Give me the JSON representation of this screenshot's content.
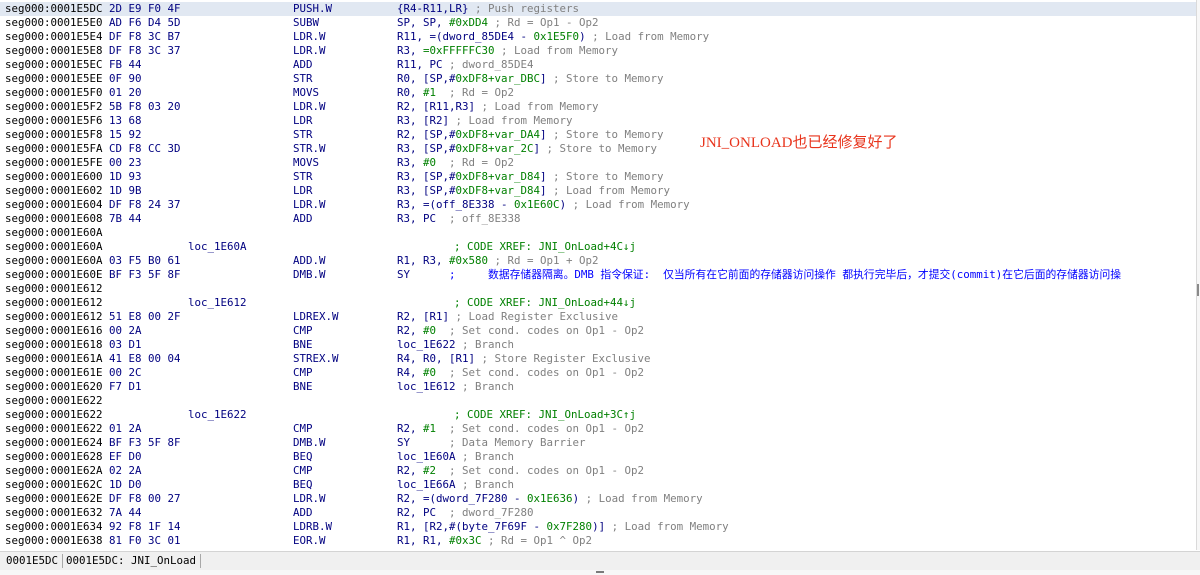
{
  "colors": {
    "address": "#000000",
    "bytes": "#000080",
    "label": "#000080",
    "mnemonic": "#000080",
    "operand": "#000080",
    "number": "#008000",
    "auto_comment": "#808080",
    "xref_comment": "#008000",
    "user_comment": "#0000ff",
    "highlight": "#e1e8f2",
    "annotation": "#e8341c"
  },
  "listing": {
    "lines": [
      {
        "addr": "seg000:0001E5DC",
        "bytes": "2D E9 F0 4F",
        "mnem": "PUSH.W",
        "ops": [
          {
            "op": "{R4-R11,LR}"
          }
        ],
        "cmt": "; Push registers",
        "current": true
      },
      {
        "addr": "seg000:0001E5E0",
        "bytes": "AD F6 D4 5D",
        "mnem": "SUBW",
        "ops": [
          {
            "op": "SP, SP, "
          },
          {
            "num": "#0xDD4"
          }
        ],
        "cmt": "; Rd = Op1 - Op2"
      },
      {
        "addr": "seg000:0001E5E4",
        "bytes": "DF F8 3C B7",
        "mnem": "LDR.W",
        "ops": [
          {
            "op": "R11, =("
          },
          {
            "ref": "dword_85DE4"
          },
          {
            "op": " - "
          },
          {
            "num": "0x1E5F0"
          },
          {
            "op": ")"
          }
        ],
        "cmt": "; Load from Memory"
      },
      {
        "addr": "seg000:0001E5E8",
        "bytes": "DF F8 3C 37",
        "mnem": "LDR.W",
        "ops": [
          {
            "op": "R3, "
          },
          {
            "num": "=0xFFFFFC30"
          }
        ],
        "cmt": "; Load from Memory"
      },
      {
        "addr": "seg000:0001E5EC",
        "bytes": "FB 44",
        "mnem": "ADD",
        "ops": [
          {
            "op": "R11, PC"
          }
        ],
        "cmt": "; dword_85DE4"
      },
      {
        "addr": "seg000:0001E5EE",
        "bytes": "0F 90",
        "mnem": "STR",
        "ops": [
          {
            "op": "R0, [SP,#"
          },
          {
            "num": "0xDF8+var_DBC"
          },
          {
            "op": "]"
          }
        ],
        "cmt": "; Store to Memory"
      },
      {
        "addr": "seg000:0001E5F0",
        "bytes": "01 20",
        "mnem": "MOVS",
        "ops": [
          {
            "op": "R0, "
          },
          {
            "num": "#1"
          }
        ],
        "cmt": "; Rd = Op2"
      },
      {
        "addr": "seg000:0001E5F2",
        "bytes": "5B F8 03 20",
        "mnem": "LDR.W",
        "ops": [
          {
            "op": "R2, [R11,R3]"
          }
        ],
        "cmt": "; Load from Memory"
      },
      {
        "addr": "seg000:0001E5F6",
        "bytes": "13 68",
        "mnem": "LDR",
        "ops": [
          {
            "op": "R3, [R2]"
          }
        ],
        "cmt": "; Load from Memory"
      },
      {
        "addr": "seg000:0001E5F8",
        "bytes": "15 92",
        "mnem": "STR",
        "ops": [
          {
            "op": "R2, [SP,#"
          },
          {
            "num": "0xDF8+var_DA4"
          },
          {
            "op": "]"
          }
        ],
        "cmt": "; Store to Memory"
      },
      {
        "addr": "seg000:0001E5FA",
        "bytes": "CD F8 CC 3D",
        "mnem": "STR.W",
        "ops": [
          {
            "op": "R3, [SP,#"
          },
          {
            "num": "0xDF8+var_2C"
          },
          {
            "op": "]"
          }
        ],
        "cmt": "; Store to Memory"
      },
      {
        "addr": "seg000:0001E5FE",
        "bytes": "00 23",
        "mnem": "MOVS",
        "ops": [
          {
            "op": "R3, "
          },
          {
            "num": "#0"
          }
        ],
        "cmt": "; Rd = Op2"
      },
      {
        "addr": "seg000:0001E600",
        "bytes": "1D 93",
        "mnem": "STR",
        "ops": [
          {
            "op": "R3, [SP,#"
          },
          {
            "num": "0xDF8+var_D84"
          },
          {
            "op": "]"
          }
        ],
        "cmt": "; Store to Memory"
      },
      {
        "addr": "seg000:0001E602",
        "bytes": "1D 9B",
        "mnem": "LDR",
        "ops": [
          {
            "op": "R3, [SP,#"
          },
          {
            "num": "0xDF8+var_D84"
          },
          {
            "op": "]"
          }
        ],
        "cmt": "; Load from Memory"
      },
      {
        "addr": "seg000:0001E604",
        "bytes": "DF F8 24 37",
        "mnem": "LDR.W",
        "ops": [
          {
            "op": "R3, =("
          },
          {
            "ref": "off_8E338"
          },
          {
            "op": " - "
          },
          {
            "num": "0x1E60C"
          },
          {
            "op": ")"
          }
        ],
        "cmt": "; Load from Memory"
      },
      {
        "addr": "seg000:0001E608",
        "bytes": "7B 44",
        "mnem": "ADD",
        "ops": [
          {
            "op": "R3, PC"
          }
        ],
        "cmt": "; off_8E338"
      },
      {
        "addr": "seg000:0001E60A"
      },
      {
        "addr": "seg000:0001E60A",
        "label": "loc_1E60A",
        "xref": "; CODE XREF: JNI_OnLoad+4C↓j"
      },
      {
        "addr": "seg000:0001E60A",
        "bytes": "03 F5 B0 61",
        "mnem": "ADD.W",
        "ops": [
          {
            "op": "R1, R3, "
          },
          {
            "num": "#0x580"
          }
        ],
        "cmt": "; Rd = Op1 + Op2"
      },
      {
        "addr": "seg000:0001E60E",
        "bytes": "BF F3 5F 8F",
        "mnem": "DMB.W",
        "ops": [
          {
            "op": "SY"
          }
        ],
        "ucmt": ";     数据存储器隔离。DMB 指令保证:  仅当所有在它前面的存储器访问操作 都执行完毕后，才提交(commit)在它后面的存储器访问操"
      },
      {
        "addr": "seg000:0001E612"
      },
      {
        "addr": "seg000:0001E612",
        "label": "loc_1E612",
        "xref": "; CODE XREF: JNI_OnLoad+44↓j"
      },
      {
        "addr": "seg000:0001E612",
        "bytes": "51 E8 00 2F",
        "mnem": "LDREX.W",
        "ops": [
          {
            "op": "R2, [R1]"
          }
        ],
        "cmt": "; Load Register Exclusive"
      },
      {
        "addr": "seg000:0001E616",
        "bytes": "00 2A",
        "mnem": "CMP",
        "ops": [
          {
            "op": "R2, "
          },
          {
            "num": "#0"
          }
        ],
        "cmt": "; Set cond. codes on Op1 - Op2"
      },
      {
        "addr": "seg000:0001E618",
        "bytes": "03 D1",
        "mnem": "BNE",
        "ops": [
          {
            "ref": "loc_1E622"
          }
        ],
        "cmt": "; Branch"
      },
      {
        "addr": "seg000:0001E61A",
        "bytes": "41 E8 00 04",
        "mnem": "STREX.W",
        "ops": [
          {
            "op": "R4, R0, [R1]"
          }
        ],
        "cmt": "; Store Register Exclusive"
      },
      {
        "addr": "seg000:0001E61E",
        "bytes": "00 2C",
        "mnem": "CMP",
        "ops": [
          {
            "op": "R4, "
          },
          {
            "num": "#0"
          }
        ],
        "cmt": "; Set cond. codes on Op1 - Op2"
      },
      {
        "addr": "seg000:0001E620",
        "bytes": "F7 D1",
        "mnem": "BNE",
        "ops": [
          {
            "ref": "loc_1E612"
          }
        ],
        "cmt": "; Branch"
      },
      {
        "addr": "seg000:0001E622"
      },
      {
        "addr": "seg000:0001E622",
        "label": "loc_1E622",
        "xref": "; CODE XREF: JNI_OnLoad+3C↑j"
      },
      {
        "addr": "seg000:0001E622",
        "bytes": "01 2A",
        "mnem": "CMP",
        "ops": [
          {
            "op": "R2, "
          },
          {
            "num": "#1"
          }
        ],
        "cmt": "; Set cond. codes on Op1 - Op2"
      },
      {
        "addr": "seg000:0001E624",
        "bytes": "BF F3 5F 8F",
        "mnem": "DMB.W",
        "ops": [
          {
            "op": "SY"
          }
        ],
        "cmt": "; Data Memory Barrier"
      },
      {
        "addr": "seg000:0001E628",
        "bytes": "EF D0",
        "mnem": "BEQ",
        "ops": [
          {
            "ref": "loc_1E60A"
          }
        ],
        "cmt": "; Branch"
      },
      {
        "addr": "seg000:0001E62A",
        "bytes": "02 2A",
        "mnem": "CMP",
        "ops": [
          {
            "op": "R2, "
          },
          {
            "num": "#2"
          }
        ],
        "cmt": "; Set cond. codes on Op1 - Op2"
      },
      {
        "addr": "seg000:0001E62C",
        "bytes": "1D D0",
        "mnem": "BEQ",
        "ops": [
          {
            "ref": "loc_1E66A"
          }
        ],
        "cmt": "; Branch"
      },
      {
        "addr": "seg000:0001E62E",
        "bytes": "DF F8 00 27",
        "mnem": "LDR.W",
        "ops": [
          {
            "op": "R2, =("
          },
          {
            "ref": "dword_7F280"
          },
          {
            "op": " - "
          },
          {
            "num": "0x1E636"
          },
          {
            "op": ")"
          }
        ],
        "cmt": "; Load from Memory"
      },
      {
        "addr": "seg000:0001E632",
        "bytes": "7A 44",
        "mnem": "ADD",
        "ops": [
          {
            "op": "R2, PC"
          }
        ],
        "cmt": "; dword_7F280"
      },
      {
        "addr": "seg000:0001E634",
        "bytes": "92 F8 1F 14",
        "mnem": "LDRB.W",
        "ops": [
          {
            "op": "R1, [R2,#("
          },
          {
            "ref": "byte_7F69F"
          },
          {
            "op": " - "
          },
          {
            "num": "0x7F280"
          },
          {
            "op": ")]"
          }
        ],
        "cmt": "; Load from Memory"
      },
      {
        "addr": "seg000:0001E638",
        "bytes": "81 F0 3C 01",
        "mnem": "EOR.W",
        "ops": [
          {
            "op": "R1, R1, "
          },
          {
            "num": "#0x3C"
          }
        ],
        "cmt": "; Rd = Op1 ^ Op2"
      }
    ]
  },
  "annotation": {
    "text": "JNI_ONLOAD也已经修复好了"
  },
  "status": {
    "address": "0001E5DC",
    "location": "0001E5DC: JNI_OnLoad"
  }
}
